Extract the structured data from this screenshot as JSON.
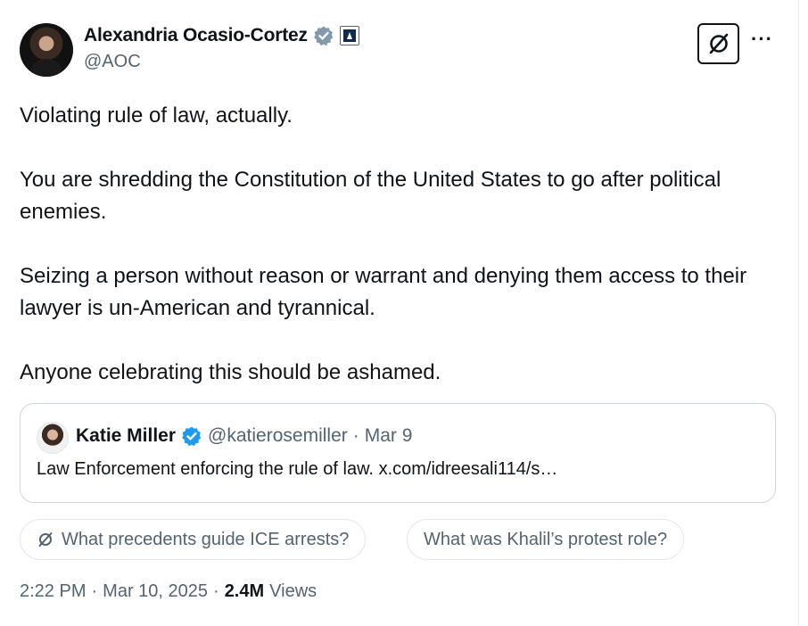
{
  "author": {
    "display_name": "Alexandria Ocasio-Cortez",
    "handle": "@AOC",
    "verified_badge_icon": "verified-badge-icon",
    "affiliation_badge_icon": "government-badge-icon"
  },
  "toolbar": {
    "grok_icon": "grok-icon",
    "more_label": "···"
  },
  "tweet": {
    "paragraphs": [
      "Violating rule of law, actually.",
      "You are shredding the Constitution of the United States to go after political enemies.",
      "Seizing a person without reason or warrant and denying them access to their lawyer is un-American and tyrannical.",
      "Anyone celebrating this should be ashamed."
    ]
  },
  "quote": {
    "name": "Katie Miller",
    "handle": "@katierosemiller",
    "separator": "·",
    "date": "Mar 9",
    "text": "Law Enforcement enforcing the rule of law.",
    "link": "x.com/idreesali114/s…"
  },
  "suggestions": [
    {
      "label": "What precedents guide ICE arrests?",
      "icon": "grok-icon"
    },
    {
      "label": "What was Khalil’s protest role?"
    }
  ],
  "meta": {
    "time": "2:22 PM",
    "separator": "·",
    "date": "Mar 10, 2025",
    "views_count": "2.4M",
    "views_label": "Views"
  },
  "colors": {
    "text": "#0f1419",
    "secondary": "#536471",
    "border": "#cfd9de",
    "verified_blue": "#1d9bf0",
    "verified_grey": "#829aab"
  }
}
